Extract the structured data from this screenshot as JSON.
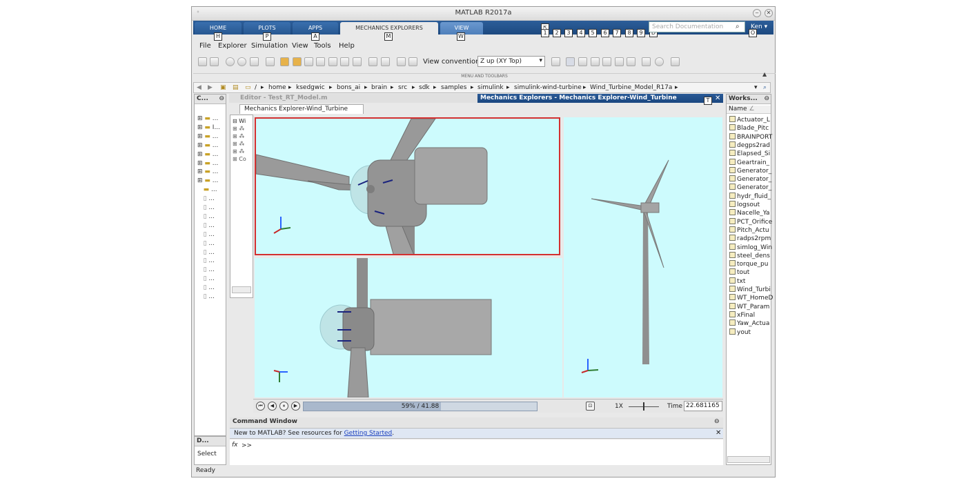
{
  "window": {
    "title": "MATLAB R2017a"
  },
  "ribbon": {
    "tabs": [
      {
        "label": "HOME",
        "key": "H"
      },
      {
        "label": "PLOTS",
        "key": "P"
      },
      {
        "label": "APPS",
        "key": "A"
      },
      {
        "label": "MECHANICS EXPLORERS",
        "key": "M"
      },
      {
        "label": "VIEW",
        "key": "W"
      }
    ],
    "quick_keys": [
      "1",
      "2",
      "3",
      "4",
      "5",
      "6",
      "7",
      "8",
      "9",
      "D"
    ],
    "search_placeholder": "Search Documentation",
    "user": "Ken",
    "user_key": "O"
  },
  "menu": {
    "items": [
      "File",
      "Explorer",
      "Simulation",
      "View",
      "Tools",
      "Help"
    ]
  },
  "toolbar": {
    "view_convention_label": "View convention:",
    "view_convention_value": "Z up (XY Top)",
    "section_label": "MENU AND TOOLBARS"
  },
  "address": {
    "root": "/",
    "segments": [
      "home",
      "ksedgwic",
      "bons_ai",
      "brain",
      "src",
      "sdk",
      "samples",
      "simulink",
      "simulink-wind-turbine",
      "Wind_Turbine_Model_R17a"
    ]
  },
  "current_folder": {
    "header": "C...",
    "rows": [
      "...",
      "I...",
      "...",
      "...",
      "...",
      "...",
      "...",
      "...",
      "...",
      "...",
      "...",
      "...",
      "...",
      "...",
      "...",
      "...",
      "...",
      "...",
      "...",
      "...",
      "..."
    ]
  },
  "details": {
    "header": "D...",
    "select_label": "Select"
  },
  "editor": {
    "title": "Editor - Test_RT_Model.m"
  },
  "mechanics": {
    "title": "Mechanics Explorers - Mechanics Explorer-Wind_Turbine",
    "title_key": "T",
    "tab": "Mechanics Explorer-Wind_Turbine",
    "tree_root": "Wi",
    "tree_last": "Co"
  },
  "playback": {
    "progress_pct": 59,
    "progress_text": "59% / 41.88",
    "speed": "1X",
    "time_label": "Time",
    "time_value": "22.681165"
  },
  "command_window": {
    "title": "Command Window",
    "new_msg": "New to MATLAB? See resources for",
    "link": "Getting Started",
    "period": ".",
    "fx": "fx",
    "prompt": ">>"
  },
  "workspace": {
    "header": "Works...",
    "col_name": "Name",
    "sort": "∠",
    "items": [
      "Actuator_L",
      "Blade_Pitc",
      "BRAINPORT",
      "degps2rad",
      "Elapsed_Si",
      "Geartrain_",
      "Generator_",
      "Generator_",
      "Generator_",
      "hydr_fluid_",
      "logsout",
      "Nacelle_Ya",
      "PCT_Orifice",
      "Pitch_Actu",
      "radps2rpm",
      "simlog_Win",
      "steel_dens",
      "torque_pu",
      "tout",
      "txt",
      "Wind_Turbi",
      "WT_HomeD",
      "WT_Param",
      "xFinal",
      "Yaw_Actua",
      "yout"
    ]
  },
  "status": {
    "text": "Ready"
  },
  "colors": {
    "ribbon": "#1d4a80",
    "viewport": "#cdfbfd",
    "selection": "#d32f2f"
  }
}
